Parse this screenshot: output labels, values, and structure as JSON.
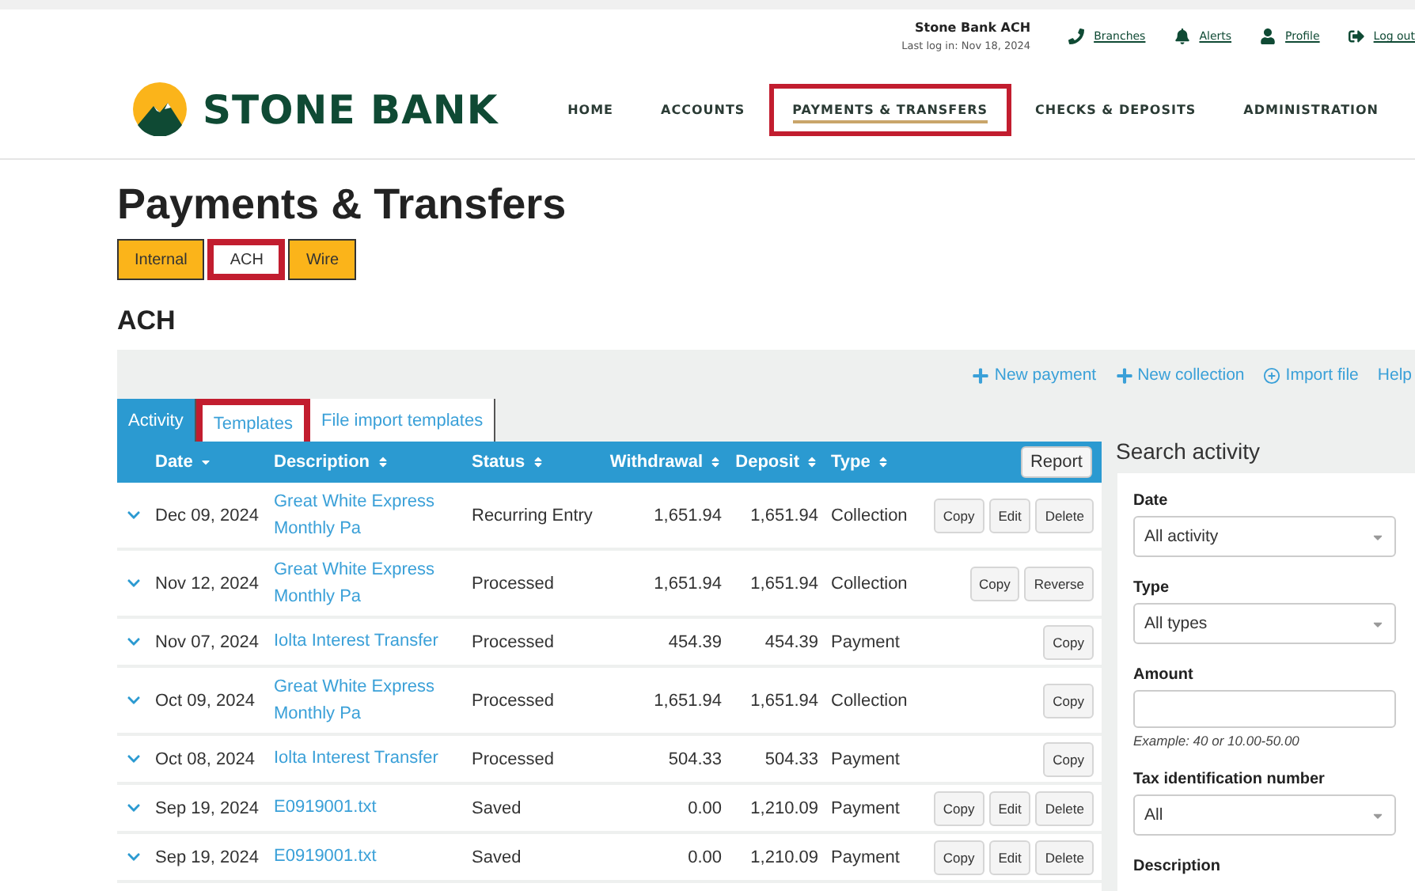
{
  "header": {
    "user": "Stone Bank ACH",
    "last_login": "Last log in: Nov 18, 2024",
    "links": [
      {
        "kind": "phone",
        "label": "Branches"
      },
      {
        "kind": "bell",
        "label": "Alerts"
      },
      {
        "kind": "user",
        "label": "Profile"
      },
      {
        "kind": "logout",
        "label": "Log out"
      }
    ]
  },
  "logo": {
    "text": "STONE BANK"
  },
  "nav": [
    {
      "label": "HOME",
      "selected": false,
      "highlighted": false
    },
    {
      "label": "ACCOUNTS",
      "selected": false,
      "highlighted": false
    },
    {
      "label": "PAYMENTS & TRANSFERS",
      "selected": true,
      "highlighted": true
    },
    {
      "label": "CHECKS & DEPOSITS",
      "selected": false,
      "highlighted": false
    },
    {
      "label": "ADMINISTRATION",
      "selected": false,
      "highlighted": false
    }
  ],
  "page_title": "Payments & Transfers",
  "tabs": [
    {
      "label": "Internal",
      "selected": false,
      "highlighted": false
    },
    {
      "label": "ACH",
      "selected": true,
      "highlighted": true
    },
    {
      "label": "Wire",
      "selected": false,
      "highlighted": false
    }
  ],
  "section_title": "ACH",
  "actions": [
    {
      "kind": "plus",
      "label": "New payment"
    },
    {
      "kind": "plus",
      "label": "New collection"
    },
    {
      "kind": "circle-plus",
      "label": "Import file"
    },
    {
      "kind": "plain",
      "label": "Help"
    }
  ],
  "subtabs": [
    {
      "label": "Activity",
      "selected": true,
      "highlighted": false
    },
    {
      "label": "Templates",
      "selected": false,
      "highlighted": true
    },
    {
      "label": "File import templates",
      "selected": false,
      "highlighted": false
    }
  ],
  "table": {
    "columns": [
      {
        "label": "Date",
        "sorted": true
      },
      {
        "label": "Description",
        "sorted": false
      },
      {
        "label": "Status",
        "sorted": false
      },
      {
        "label": "Withdrawal",
        "sorted": false
      },
      {
        "label": "Deposit",
        "sorted": false
      },
      {
        "label": "Type",
        "sorted": false
      }
    ],
    "report_button": "Report",
    "rows": [
      {
        "date": "Dec 09, 2024",
        "description": "Great White Express Monthly Pa",
        "status": "Recurring Entry",
        "withdrawal": "1,651.94",
        "deposit": "1,651.94",
        "type": "Collection",
        "buttons": [
          "Copy",
          "Edit",
          "Delete"
        ]
      },
      {
        "date": "Nov 12, 2024",
        "description": "Great White Express Monthly Pa",
        "status": "Processed",
        "withdrawal": "1,651.94",
        "deposit": "1,651.94",
        "type": "Collection",
        "buttons": [
          "Copy",
          "Reverse"
        ]
      },
      {
        "date": "Nov 07, 2024",
        "description": "Iolta Interest Transfer",
        "status": "Processed",
        "withdrawal": "454.39",
        "deposit": "454.39",
        "type": "Payment",
        "buttons": [
          "Copy"
        ]
      },
      {
        "date": "Oct 09, 2024",
        "description": "Great White Express Monthly Pa",
        "status": "Processed",
        "withdrawal": "1,651.94",
        "deposit": "1,651.94",
        "type": "Collection",
        "buttons": [
          "Copy"
        ]
      },
      {
        "date": "Oct 08, 2024",
        "description": "Iolta Interest Transfer",
        "status": "Processed",
        "withdrawal": "504.33",
        "deposit": "504.33",
        "type": "Payment",
        "buttons": [
          "Copy"
        ]
      },
      {
        "date": "Sep 19, 2024",
        "description": "E0919001.txt",
        "status": "Saved",
        "withdrawal": "0.00",
        "deposit": "1,210.09",
        "type": "Payment",
        "buttons": [
          "Copy",
          "Edit",
          "Delete"
        ]
      },
      {
        "date": "Sep 19, 2024",
        "description": "E0919001.txt",
        "status": "Saved",
        "withdrawal": "0.00",
        "deposit": "1,210.09",
        "type": "Payment",
        "buttons": [
          "Copy",
          "Edit",
          "Delete"
        ]
      }
    ]
  },
  "search": {
    "title": "Search activity",
    "fields": [
      {
        "kind": "select",
        "label": "Date",
        "value": "All activity"
      },
      {
        "kind": "select",
        "label": "Type",
        "value": "All types"
      },
      {
        "kind": "input",
        "label": "Amount",
        "hint": "Example: 40 or 10.00-50.00"
      },
      {
        "kind": "select",
        "label": "Tax identification number",
        "value": "All"
      },
      {
        "kind": "cut",
        "label": "Description"
      }
    ]
  }
}
